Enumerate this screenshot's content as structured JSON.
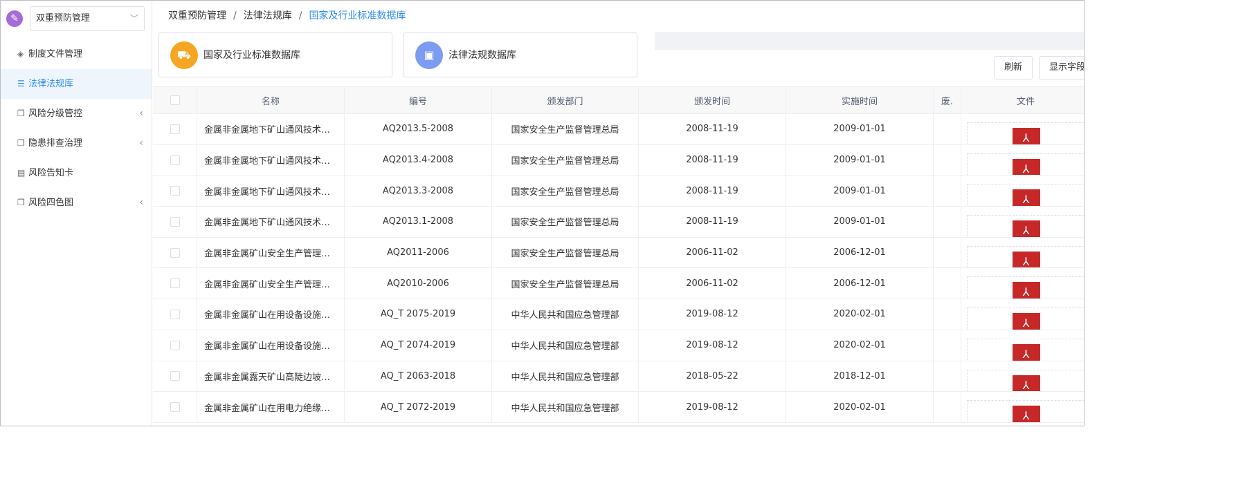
{
  "system": {
    "logo_icon": "wrench-icon",
    "name": "双重预防管理"
  },
  "sidebar": {
    "items": [
      {
        "label": "制度文件管理",
        "icon": "layers-icon",
        "active": false,
        "expandable": false
      },
      {
        "label": "法律法规库",
        "icon": "database-icon",
        "active": true,
        "expandable": false
      },
      {
        "label": "风险分级管控",
        "icon": "copy-icon",
        "active": false,
        "expandable": true
      },
      {
        "label": "隐患排查治理",
        "icon": "copy-icon",
        "active": false,
        "expandable": true
      },
      {
        "label": "风险告知卡",
        "icon": "document-icon",
        "active": false,
        "expandable": false
      },
      {
        "label": "风险四色图",
        "icon": "copy-icon",
        "active": false,
        "expandable": true
      }
    ]
  },
  "breadcrumb": {
    "items": [
      "双重预防管理",
      "法律法规库",
      "国家及行业标准数据库"
    ],
    "separator": "/"
  },
  "cards": [
    {
      "title": "国家及行业标准数据库",
      "icon": "forklift-icon",
      "color": "#f5a623"
    },
    {
      "title": "法律法规数据库",
      "icon": "law-book-icon",
      "color": "#7b9cf0"
    }
  ],
  "toolbar": {
    "refresh_label": "刷新",
    "columns_label": "显示字段"
  },
  "table": {
    "columns": [
      "名称",
      "编号",
      "颁发部门",
      "颁发时间",
      "实施时间",
      "废.",
      "文件"
    ],
    "rows": [
      {
        "name": "金属非金属地下矿山通风技术…",
        "code": "AQ2013.5-2008",
        "dept": "国家安全生产监督管理总局",
        "issued": "2008-11-19",
        "effective": "2009-01-01",
        "abolished": ""
      },
      {
        "name": "金属非金属地下矿山通风技术…",
        "code": "AQ2013.4-2008",
        "dept": "国家安全生产监督管理总局",
        "issued": "2008-11-19",
        "effective": "2009-01-01",
        "abolished": ""
      },
      {
        "name": "金属非金属地下矿山通风技术…",
        "code": "AQ2013.3-2008",
        "dept": "国家安全生产监督管理总局",
        "issued": "2008-11-19",
        "effective": "2009-01-01",
        "abolished": ""
      },
      {
        "name": "金属非金属地下矿山通风技术…",
        "code": "AQ2013.1-2008",
        "dept": "国家安全生产监督管理总局",
        "issued": "2008-11-19",
        "effective": "2009-01-01",
        "abolished": ""
      },
      {
        "name": "金属非金属矿山安全生产管理…",
        "code": "AQ2011-2006",
        "dept": "国家安全生产监督管理总局",
        "issued": "2006-11-02",
        "effective": "2006-12-01",
        "abolished": ""
      },
      {
        "name": "金属非金属矿山安全生产管理…",
        "code": "AQ2010-2006",
        "dept": "国家安全生产监督管理总局",
        "issued": "2006-11-02",
        "effective": "2006-12-01",
        "abolished": ""
      },
      {
        "name": "金属非金属矿山在用设备设施…",
        "code": "AQ_T 2075-2019",
        "dept": "中华人民共和国应急管理部",
        "issued": "2019-08-12",
        "effective": "2020-02-01",
        "abolished": ""
      },
      {
        "name": "金属非金属矿山在用设备设施…",
        "code": "AQ_T 2074-2019",
        "dept": "中华人民共和国应急管理部",
        "issued": "2019-08-12",
        "effective": "2020-02-01",
        "abolished": ""
      },
      {
        "name": "金属非金属露天矿山高陡边坡…",
        "code": "AQ_T 2063-2018",
        "dept": "中华人民共和国应急管理部",
        "issued": "2018-05-22",
        "effective": "2018-12-01",
        "abolished": ""
      },
      {
        "name": "金属非金属矿山在用电力绝缘…",
        "code": "AQ_T 2072-2019",
        "dept": "中华人民共和国应急管理部",
        "issued": "2019-08-12",
        "effective": "2020-02-01",
        "abolished": ""
      }
    ],
    "file_icon": "pdf-icon"
  }
}
